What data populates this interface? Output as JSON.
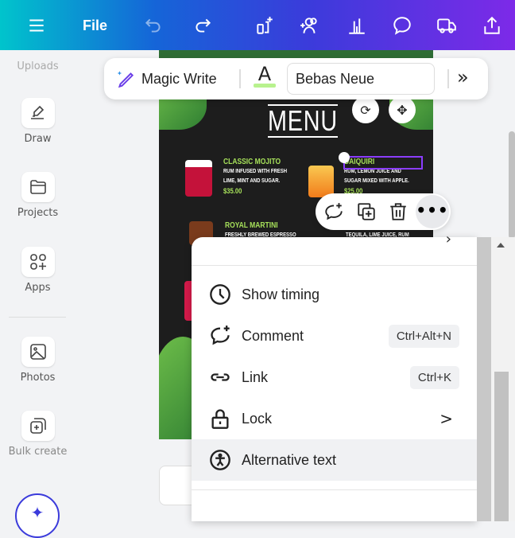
{
  "topbar": {
    "file_label": "File",
    "icons": [
      "menu-icon",
      "undo-icon",
      "redo-icon",
      "magic-resize-icon",
      "share-people-icon",
      "insights-icon",
      "comment-icon",
      "delivery-truck-icon",
      "upload-share-icon"
    ]
  },
  "sidebar": {
    "uploads_label": "Uploads",
    "items": [
      {
        "label": "Draw",
        "icon": "draw-icon"
      },
      {
        "label": "Projects",
        "icon": "folder-icon"
      },
      {
        "label": "Apps",
        "icon": "apps-icon"
      },
      {
        "label": "Photos",
        "icon": "photo-icon"
      },
      {
        "label": "Bulk create",
        "icon": "bulk-create-icon"
      }
    ]
  },
  "text_toolbar": {
    "magic_write_label": "Magic Write",
    "font_color_glyph": "A",
    "font_color": "#b8f28e",
    "font_name": "Bebas Neue",
    "more_glyph": "»"
  },
  "design": {
    "title": "MENU",
    "items": [
      {
        "name": "CLASSIC MOJITO",
        "desc1": "RUM INFUSED WITH FRESH",
        "desc2": "LIME, MINT AND SUGAR.",
        "price": "$35.00"
      },
      {
        "name": "DAIQUIRI",
        "desc1": "RUM, LEMON JUICE AND",
        "desc2": "SUGAR MIXED WITH APPLE.",
        "price": "$25.00"
      },
      {
        "name": "ROYAL MARTINI",
        "desc1": "FRESHLY BREWED ESPRESSO",
        "desc2": "",
        "price": ""
      },
      {
        "name": "",
        "desc1": "TEQUILA, LIME JUICE, RUM",
        "desc2": "",
        "price": ""
      }
    ],
    "accent_color": "#a6e05a",
    "selection_color": "#8b3dff"
  },
  "context_toolbar": {
    "more_label": "•••"
  },
  "dropdown": {
    "items": [
      {
        "label": "Show timing",
        "icon": "clock-icon",
        "shortcut": ""
      },
      {
        "label": "Comment",
        "icon": "comment-add-icon",
        "shortcut": "Ctrl+Alt+N"
      },
      {
        "label": "Link",
        "icon": "link-icon",
        "shortcut": "Ctrl+K"
      },
      {
        "label": "Lock",
        "icon": "lock-icon",
        "shortcut": "",
        "submenu": ">"
      },
      {
        "label": "Alternative text",
        "icon": "accessibility-icon",
        "shortcut": ""
      }
    ],
    "top_chevron": "›"
  }
}
